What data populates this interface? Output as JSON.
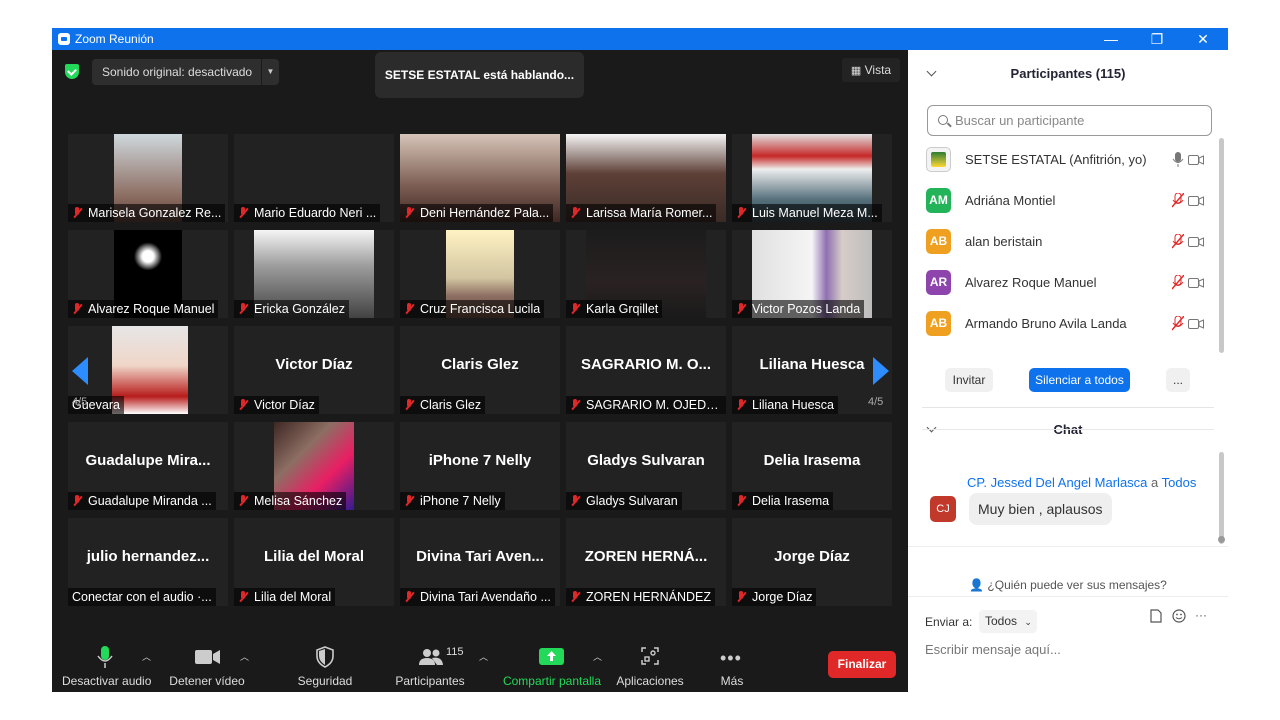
{
  "window": {
    "title": "Zoom Reunión",
    "controls": [
      "—",
      "❐",
      "✕"
    ]
  },
  "meeting": {
    "sound": "Sonido original: desactivado",
    "speaking": "SETSE ESTATAL está hablando...",
    "view": "Vista",
    "page": "4/5",
    "tiles": [
      {
        "label": "Marisela Gonzalez Re...",
        "video": true
      },
      {
        "label": "Mario Eduardo Neri ...",
        "video": false
      },
      {
        "label": "Deni Hernández Pala...",
        "video": true
      },
      {
        "label": "Larissa María Romer...",
        "video": true
      },
      {
        "label": "Luis Manuel Meza M...",
        "video": true
      },
      {
        "label": "Alvarez Roque Manuel",
        "video": true
      },
      {
        "label": "Ericka González",
        "video": true
      },
      {
        "label": "Cruz Francisca Lucila",
        "video": true
      },
      {
        "label": "Karla Grqillet",
        "video": true
      },
      {
        "label": "Victor Pozos Landa",
        "video": true
      },
      {
        "label": "Guevara",
        "video": true
      },
      {
        "name": "Victor Díaz",
        "label": "Victor Díaz"
      },
      {
        "name": "Claris Glez",
        "label": "Claris Glez"
      },
      {
        "name": "SAGRARIO M. O...",
        "label": "SAGRARIO M. OJEDA..."
      },
      {
        "name": "Liliana Huesca",
        "label": "Liliana Huesca"
      },
      {
        "name": "Guadalupe  Mira...",
        "label": "Guadalupe Miranda ..."
      },
      {
        "label": "Melisa Sánchez",
        "video": true
      },
      {
        "name": "iPhone 7 Nelly",
        "label": "iPhone 7 Nelly"
      },
      {
        "name": "Gladys Sulvaran",
        "label": "Gladys Sulvaran"
      },
      {
        "name": "Delia Irasema",
        "label": "Delia Irasema"
      },
      {
        "name": "julio  hernandez...",
        "label": "Conectar con el audio ·...",
        "nomic": true
      },
      {
        "name": "Lilia del Moral",
        "label": "Lilia del Moral"
      },
      {
        "name": "Divina Tari Aven...",
        "label": "Divina Tari Avendaño ..."
      },
      {
        "name": "ZOREN  HERNÁ...",
        "label": "ZOREN HERNÁNDEZ"
      },
      {
        "name": "Jorge Díaz",
        "label": "Jorge Díaz"
      }
    ]
  },
  "toolbar": {
    "mute": "Desactivar audio",
    "video": "Detener vídeo",
    "security": "Seguridad",
    "participants": "Participantes",
    "participants_count": "115",
    "share": "Compartir pantalla",
    "apps": "Aplicaciones",
    "more": "Más",
    "end": "Finalizar"
  },
  "participants": {
    "title": "Participantes (115)",
    "search_placeholder": "Buscar un participante",
    "list": [
      {
        "initials": "",
        "name": "SETSE ESTATAL (Anfitrión, yo)",
        "color": "#f3f3f3"
      },
      {
        "initials": "AM",
        "name": "Adriána Montiel",
        "color": "#23b45a"
      },
      {
        "initials": "AB",
        "name": "alan beristain",
        "color": "#f0a020"
      },
      {
        "initials": "AR",
        "name": "Alvarez Roque Manuel",
        "color": "#8e44ad"
      },
      {
        "initials": "AB",
        "name": "Armando Bruno Avila Landa",
        "color": "#f0a020"
      }
    ],
    "invite": "Invitar",
    "mute_all": "Silenciar a todos",
    "more": "..."
  },
  "chat": {
    "title": "Chat",
    "sender": "CP. Jessed  Del Angel Marlasca",
    "a": "a",
    "to": "Todos",
    "initials": "CJ",
    "message": "Muy bien , aplausos",
    "who": "¿Quién puede ver sus mensajes?",
    "send_to_label": "Enviar a:",
    "send_to": "Todos",
    "placeholder": "Escribir mensaje aquí..."
  }
}
